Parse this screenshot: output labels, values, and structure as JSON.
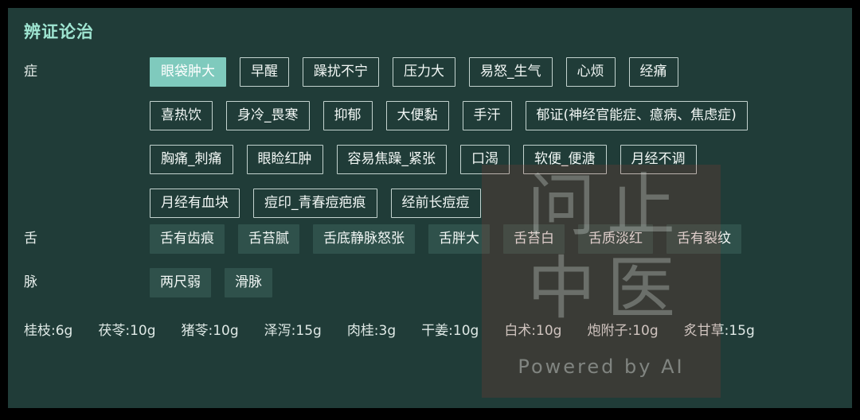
{
  "card": {
    "title": "辨证论治"
  },
  "sections": [
    {
      "key": "zheng",
      "label": "症",
      "rows": [
        [
          {
            "text": "眼袋肿大",
            "state": "selected"
          },
          {
            "text": "早醒",
            "state": "outlined"
          },
          {
            "text": "躁扰不宁",
            "state": "outlined"
          },
          {
            "text": "压力大",
            "state": "outlined"
          },
          {
            "text": "易怒_生气",
            "state": "outlined"
          },
          {
            "text": "心烦",
            "state": "outlined"
          },
          {
            "text": "经痛",
            "state": "outlined"
          }
        ],
        [
          {
            "text": "喜热饮",
            "state": "outlined"
          },
          {
            "text": "身冷_畏寒",
            "state": "outlined"
          },
          {
            "text": "抑郁",
            "state": "outlined"
          },
          {
            "text": "大便黏",
            "state": "outlined"
          },
          {
            "text": "手汗",
            "state": "outlined"
          },
          {
            "text": "郁证(神经官能症、癔病、焦虑症)",
            "state": "outlined"
          }
        ],
        [
          {
            "text": "胸痛_刺痛",
            "state": "outlined"
          },
          {
            "text": "眼睑红肿",
            "state": "outlined"
          },
          {
            "text": "容易焦躁_紧张",
            "state": "outlined"
          },
          {
            "text": "口渴",
            "state": "outlined"
          },
          {
            "text": "软便_便溏",
            "state": "outlined"
          },
          {
            "text": "月经不调",
            "state": "outlined"
          }
        ],
        [
          {
            "text": "月经有血块",
            "state": "outlined"
          },
          {
            "text": "痘印_青春痘疤痕",
            "state": "outlined"
          },
          {
            "text": "经前长痘痘",
            "state": "outlined"
          }
        ]
      ]
    },
    {
      "key": "she",
      "label": "舌",
      "rows": [
        [
          {
            "text": "舌有齿痕",
            "state": "filled"
          },
          {
            "text": "舌苔腻",
            "state": "filled"
          },
          {
            "text": "舌底静脉怒张",
            "state": "filled"
          },
          {
            "text": "舌胖大",
            "state": "filled"
          },
          {
            "text": "舌苔白",
            "state": "filled"
          },
          {
            "text": "舌质淡红",
            "state": "filled"
          },
          {
            "text": "舌有裂纹",
            "state": "filled"
          }
        ]
      ]
    },
    {
      "key": "mai",
      "label": "脉",
      "rows": [
        [
          {
            "text": "两尺弱",
            "state": "filled"
          },
          {
            "text": "滑脉",
            "state": "filled"
          }
        ]
      ]
    }
  ],
  "prescription": {
    "herbs": [
      {
        "name": "桂枝",
        "dose": "6g",
        "text": "桂枝:6g"
      },
      {
        "name": "茯苓",
        "dose": "10g",
        "text": "茯苓:10g"
      },
      {
        "name": "猪苓",
        "dose": "10g",
        "text": "猪苓:10g"
      },
      {
        "name": "泽泻",
        "dose": "15g",
        "text": "泽泻:15g"
      },
      {
        "name": "肉桂",
        "dose": "3g",
        "text": "肉桂:3g"
      },
      {
        "name": "干姜",
        "dose": "10g",
        "text": "干姜:10g"
      },
      {
        "name": "白术",
        "dose": "10g",
        "text": "白术:10g"
      },
      {
        "name": "炮附子",
        "dose": "10g",
        "text": "炮附子:10g"
      },
      {
        "name": "炙甘草",
        "dose": "15g",
        "text": "炙甘草:15g"
      }
    ]
  },
  "watermark": {
    "line1": "问止",
    "line2": "中医",
    "powered": "Powered by AI"
  },
  "colors": {
    "card_background": "#203c38",
    "page_background": "#000000",
    "title": "#9fe6d2",
    "selected_tag": "#7fcabd",
    "filled_tag": "#2f514b",
    "tag_border": "#c3d3cf",
    "text": "#f2f7f5"
  }
}
